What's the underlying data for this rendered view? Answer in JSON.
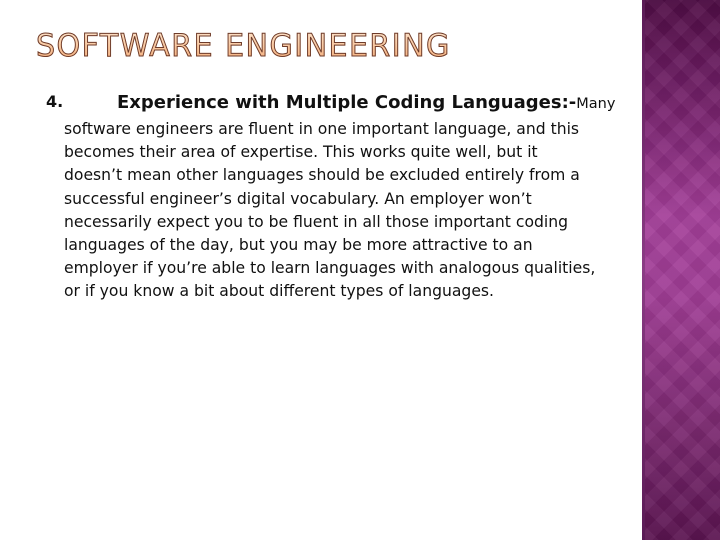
{
  "slide": {
    "title": "SOFTWARE ENGINEERING",
    "item_number": "4.",
    "item_heading": "Experience with Multiple Coding Languages:-",
    "item_lead_word": "Many",
    "body_lines": [
      "software engineers are fluent in one important language, and this",
      "becomes their area of expertise. This works quite well, but it",
      "doesn’t mean other languages should be excluded entirely from a",
      "successful engineer’s digital vocabulary. An employer won’t",
      "necessarily expect you to be fluent in all those important coding",
      "languages of the day, but you may be more attractive to an",
      "employer if you’re able to learn languages with analogous qualities,",
      "or if you know a bit about different types of languages."
    ]
  },
  "theme": {
    "accent_band_color": "#a43f99",
    "title_fill_color": "#f9c8a0",
    "title_outline_color": "#6d3b2a",
    "text_color": "#111111"
  }
}
